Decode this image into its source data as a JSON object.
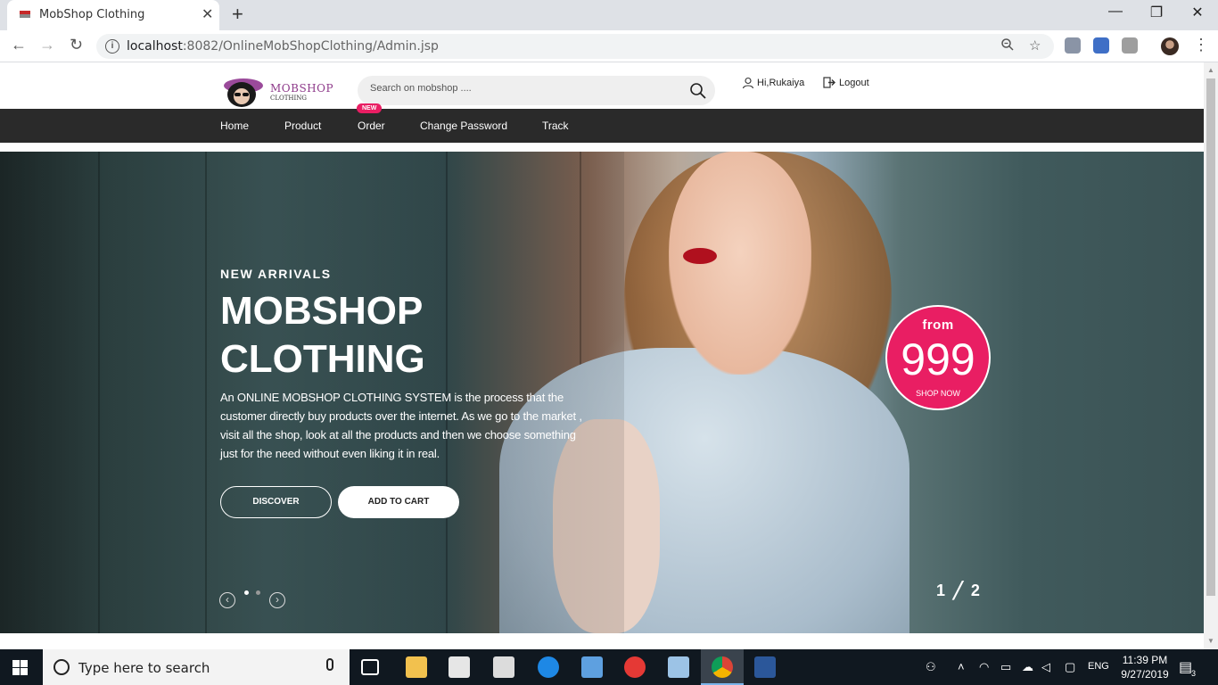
{
  "browser": {
    "tab_title": "MobShop Clothing",
    "tab_close": "✕",
    "new_tab": "+",
    "url_host": "localhost",
    "url_rest": ":8082/OnlineMobShopClothing/Admin.jsp",
    "window_controls": {
      "minimize": "—",
      "maximize": "❐",
      "close": "✕"
    }
  },
  "header": {
    "logo_text": "MOBSHOP",
    "logo_sub": "CLOTHING",
    "search_placeholder": "Search on mobshop ....",
    "user_greeting": "Hi,Rukaiya",
    "logout_label": "Logout"
  },
  "nav": {
    "items": [
      {
        "label": "Home"
      },
      {
        "label": "Product"
      },
      {
        "label": "Order"
      },
      {
        "label": "Change Password"
      },
      {
        "label": "Track"
      }
    ],
    "new_badge": "NEW"
  },
  "hero": {
    "eyebrow": "NEW ARRIVALS",
    "title_line1": "MOBSHOP",
    "title_line2": "CLOTHING",
    "description": "An ONLINE MOBSHOP CLOTHING SYSTEM is the process that the customer directly buy products over the internet. As we go to the market , visit all the shop, look at all the products and then we choose something just for the need without even liking it in real.",
    "discover_label": "DISCOVER",
    "add_to_cart_label": "ADD TO CART",
    "price_from": "from",
    "price_value": "999",
    "price_cta": "SHOP NOW",
    "slide_counter": "1 ╱ 2"
  },
  "taskbar": {
    "search_placeholder": "Type here to search",
    "time": "11:39 PM",
    "date": "9/27/2019",
    "language": "ENG",
    "notification_count": "3"
  },
  "colors": {
    "accent": "#e91e63",
    "nav_bg": "#2a2a2a",
    "brand": "#8e3a8a"
  }
}
